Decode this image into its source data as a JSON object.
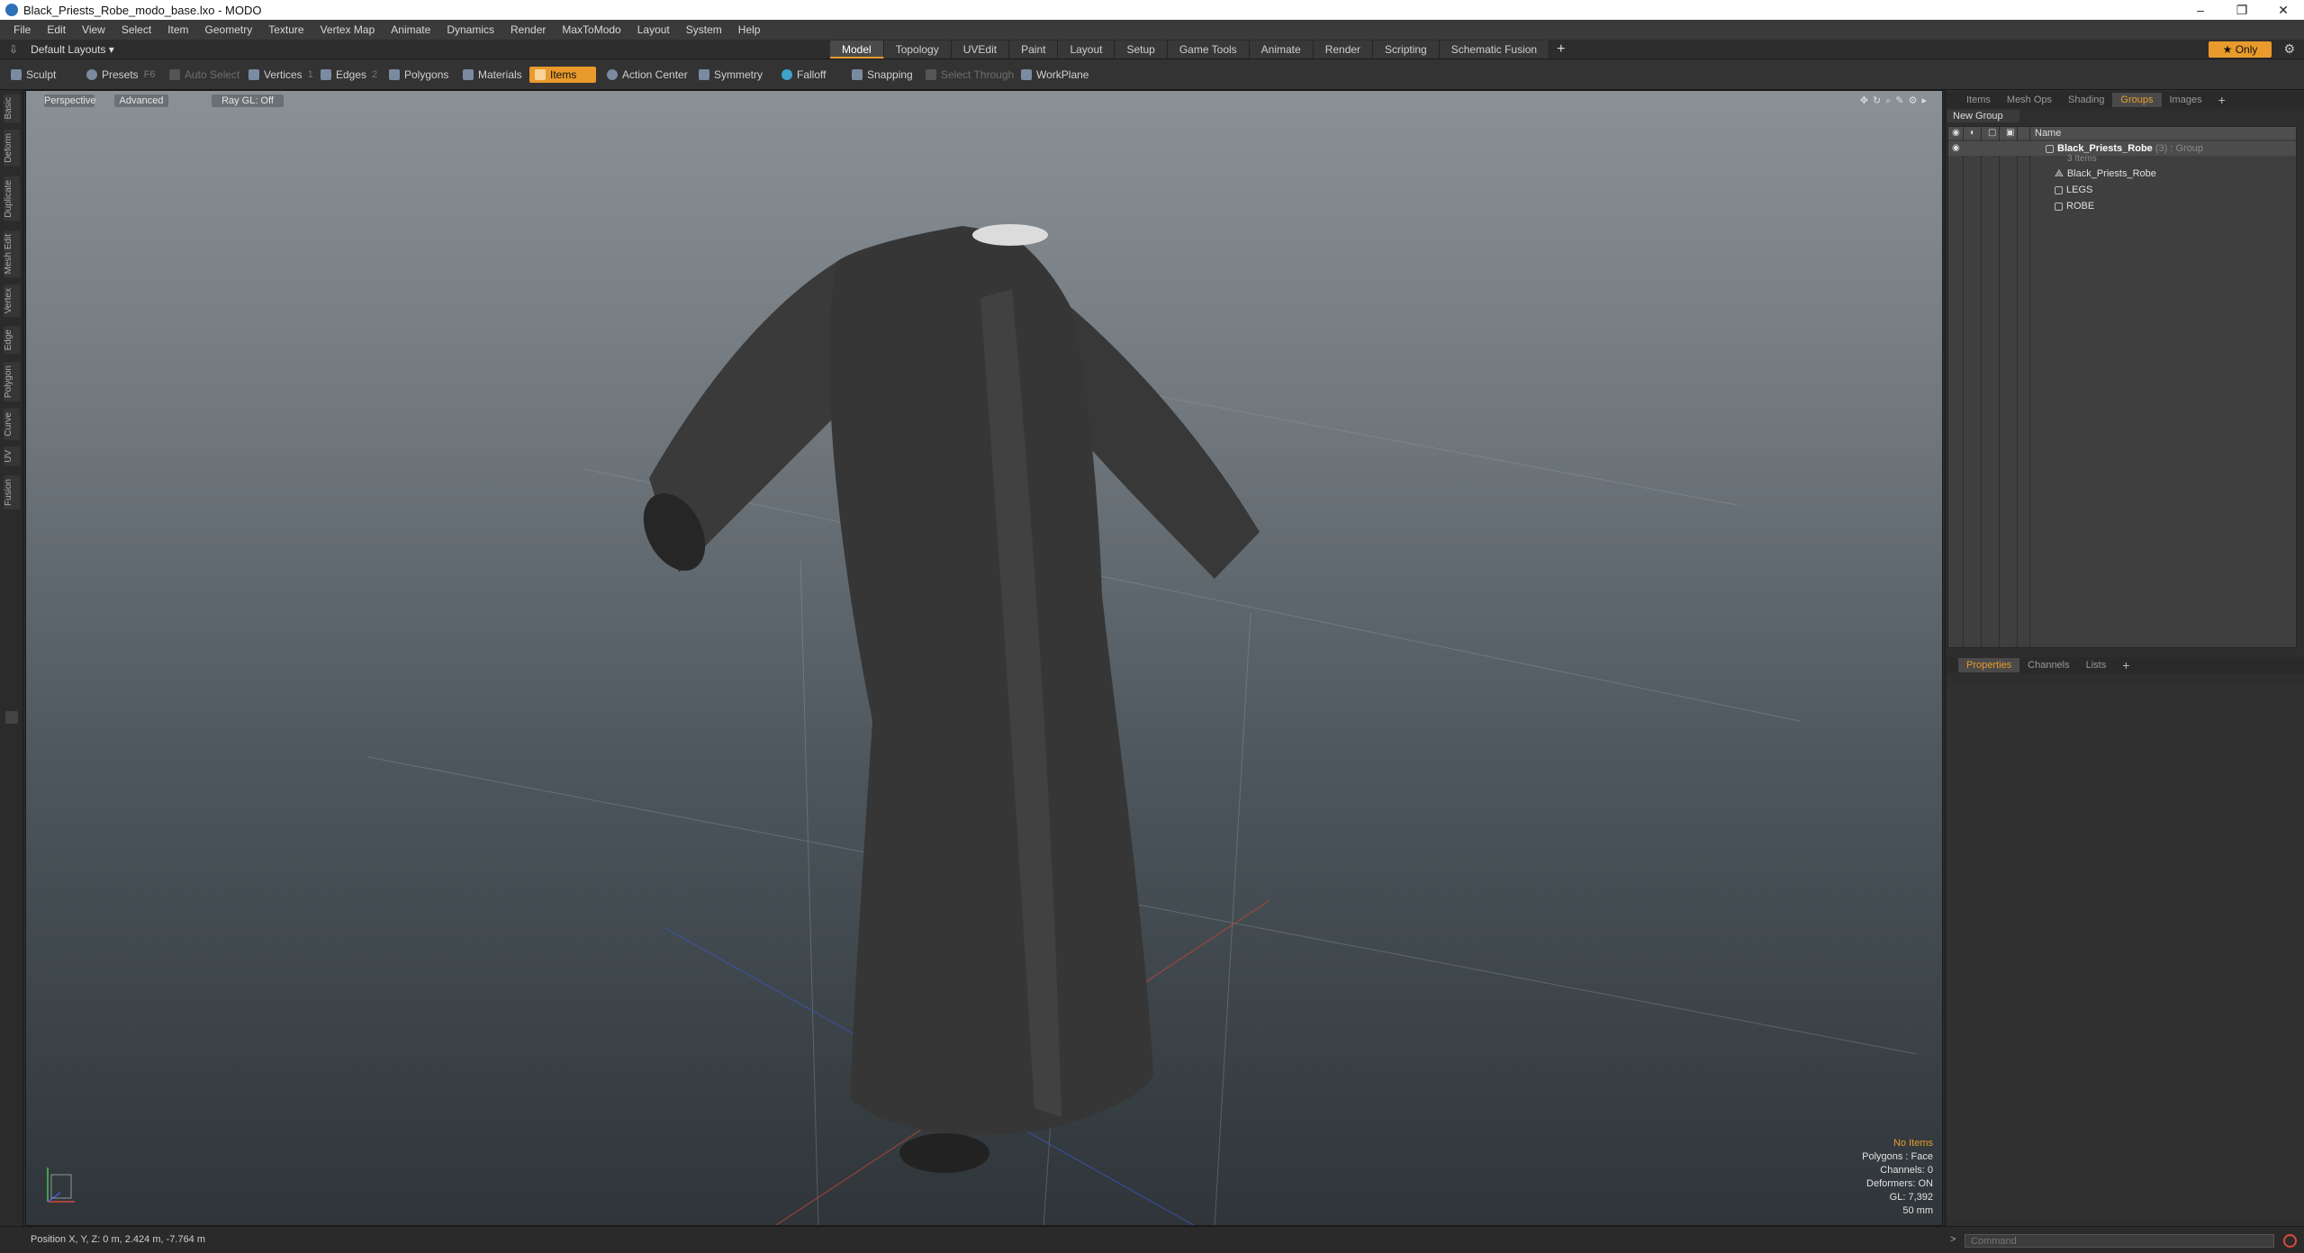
{
  "window": {
    "title": "Black_Priests_Robe_modo_base.lxo - MODO",
    "minimize": "–",
    "maximize": "❐",
    "close": "✕"
  },
  "menu": [
    "File",
    "Edit",
    "View",
    "Select",
    "Item",
    "Geometry",
    "Texture",
    "Vertex Map",
    "Animate",
    "Dynamics",
    "Render",
    "MaxToModo",
    "Layout",
    "System",
    "Help"
  ],
  "layouts": {
    "label": "Default Layouts ▾"
  },
  "tabs": [
    "Model",
    "Topology",
    "UVEdit",
    "Paint",
    "Layout",
    "Setup",
    "Game Tools",
    "Animate",
    "Render",
    "Scripting",
    "Schematic Fusion"
  ],
  "tabs_active": "Model",
  "only_label": "★  Only",
  "toolbar": {
    "sculpt": "Sculpt",
    "presets": "Presets",
    "presets_key": "F6",
    "auto_select": "Auto Select",
    "vertices": "Vertices",
    "vertices_key": "1",
    "edges": "Edges",
    "edges_key": "2",
    "polygons": "Polygons",
    "materials": "Materials",
    "items": "Items",
    "action_center": "Action Center",
    "symmetry": "Symmetry",
    "falloff": "Falloff",
    "snapping": "Snapping",
    "select_through": "Select Through",
    "workplane": "WorkPlane"
  },
  "left_tabs": [
    "Basic",
    "Deform",
    "Duplicate",
    "Mesh Edit",
    "Vertex",
    "Edge",
    "Polygon",
    "Curve",
    "UV",
    "Fusion"
  ],
  "viewport": {
    "view": "Perspective",
    "shading": "Advanced",
    "raygl": "Ray GL: Off",
    "info": {
      "selection": "No Items",
      "polygons": "Polygons : Face",
      "channels": "Channels: 0",
      "deformers": "Deformers: ON",
      "gl": "GL: 7,392",
      "scale": "50 mm"
    }
  },
  "panel_top_tabs": [
    "Items",
    "Mesh Ops",
    "Shading",
    "Groups",
    "Images"
  ],
  "panel_top_active": "Groups",
  "groups": {
    "new_group": "New Group",
    "col_name": "Name",
    "root": {
      "name": "Black_Priests_Robe",
      "count": "(3)",
      "type": ": Group",
      "sub": "3 Items"
    },
    "children": [
      "Black_Priests_Robe",
      "LEGS",
      "ROBE"
    ]
  },
  "panel_bottom_tabs": [
    "Properties",
    "Channels",
    "Lists"
  ],
  "panel_bottom_active": "Properties",
  "status": {
    "position": "Position X, Y, Z:  0 m, 2.424 m, -7.764 m"
  },
  "command": {
    "placeholder": "Command"
  },
  "colors": {
    "accent": "#e89a2b",
    "viewport_top": "#8a9196",
    "viewport_bottom": "#2f3539"
  }
}
